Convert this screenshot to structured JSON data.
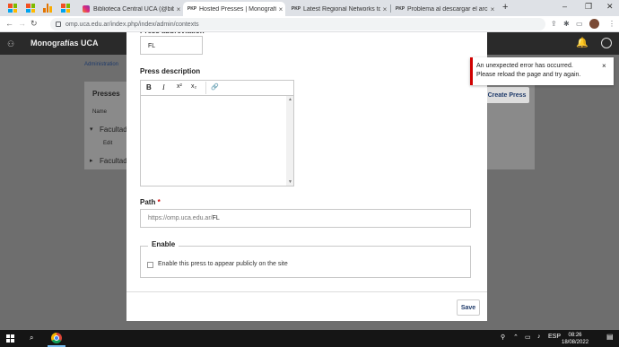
{
  "browser": {
    "tabs": [
      {
        "label": "Biblioteca Central UCA (@bibliot",
        "favicon": "instagram-icon"
      },
      {
        "label": "Hosted Presses | Monografías U",
        "favicon": "pkp-icon",
        "active": true
      },
      {
        "label": "Latest Regional Networks topic",
        "favicon": "pkp-icon"
      },
      {
        "label": "Problema al descargar el archivo",
        "favicon": "pkp-icon"
      }
    ],
    "tab_close": "×",
    "new_tab": "+",
    "url": "omp.uca.edu.ar/index.php/index/admin/contexts",
    "window_controls": {
      "minimize": "–",
      "restore": "❐",
      "close": "✕"
    }
  },
  "app": {
    "site_title": "Monografías UCA"
  },
  "background": {
    "breadcrumb": "Administration",
    "panel_title": "Presses",
    "column_name": "Name",
    "row1": "Facultad",
    "row1_sub": "Edit",
    "row2": "Facultad",
    "create_press": "Create Press"
  },
  "modal": {
    "abbreviation_label": "Press abbreviation",
    "abbreviation_value": "FL",
    "description_label": "Press description",
    "toolbar": {
      "bold": "B",
      "italic": "I",
      "superscript": "x²",
      "subscript": "x₂",
      "link": "🔗"
    },
    "path_label": "Path",
    "path_required": "*",
    "path_prefix": "https://omp.uca.edu.ar/",
    "path_value": "FL",
    "enable_legend": "Enable",
    "enable_checkbox_label": "Enable this press to appear publicly on the site",
    "save_label": "Save"
  },
  "notification": {
    "message": "An unexpected error has occurred. Please reload the page and try again.",
    "close": "×",
    "accent_color": "#d00000"
  },
  "taskbar": {
    "language": "ESP",
    "time": "08:26",
    "date": "18/08/2022"
  }
}
